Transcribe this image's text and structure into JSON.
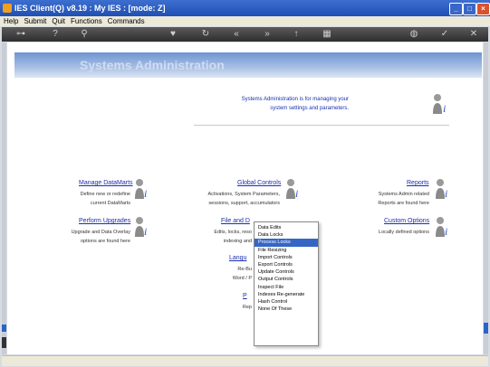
{
  "window": {
    "title": "IES Client(Q) v8.19 : My IES :      [mode: Z]",
    "buttons": [
      "minimize",
      "maximize",
      "close"
    ]
  },
  "menubar": [
    "Help",
    "Submit",
    "Quit",
    "Functions",
    "Commands"
  ],
  "toolbar": {
    "icons": [
      "key-icon",
      "help-icon",
      "search-icon",
      "heart-icon",
      "refresh-icon",
      "back-icon",
      "forward-icon",
      "up-icon",
      "grid-icon",
      "globe-icon",
      "check-icon",
      "close-icon"
    ]
  },
  "page": {
    "banner_title": "Systems Administration",
    "intro_line1": "Systems Administration is for managing your",
    "intro_line2": "system settings and parameters."
  },
  "sections": {
    "manage_datamarts": {
      "title": "Manage DataMarts",
      "desc1": "Define new or redefine",
      "desc2": "current DataMarts"
    },
    "perform_upgrades": {
      "title": "Perform Upgrades",
      "desc1": "Upgrade and Data Overlay",
      "desc2": "options are found here"
    },
    "global_controls": {
      "title": "Global Controls",
      "desc1": "Activations, System Parameters,",
      "desc2": "sessions, support, accumulators"
    },
    "file_and": {
      "title": "File and D",
      "desc1": "Edits, locks, reso",
      "desc2": "indexing and"
    },
    "language": {
      "title": "Langu",
      "desc1": "Re-Bu",
      "desc2": "Word / P"
    },
    "p_section": {
      "title": "P",
      "desc1": "Rep"
    },
    "reports": {
      "title": "Reports",
      "desc1": "Systems Admin related",
      "desc2": "Reports are found here"
    },
    "custom_options": {
      "title": "Custom Options",
      "desc1": "Locally defined options"
    }
  },
  "popup_menu": {
    "items": [
      "Data Edits",
      "Data Locks",
      "Process Locks",
      "File Resizing",
      "Import Controls",
      "Export Controls",
      "Update Controls",
      "Output Controls",
      "Inspect File",
      "Indexes Re-generate",
      "Hash Control",
      "None Of These"
    ],
    "selected": "Process Locks"
  },
  "colors": {
    "link": "#1a2fae",
    "menu_highlight": "#3566c5",
    "title_bar": "#2b5cc4"
  }
}
